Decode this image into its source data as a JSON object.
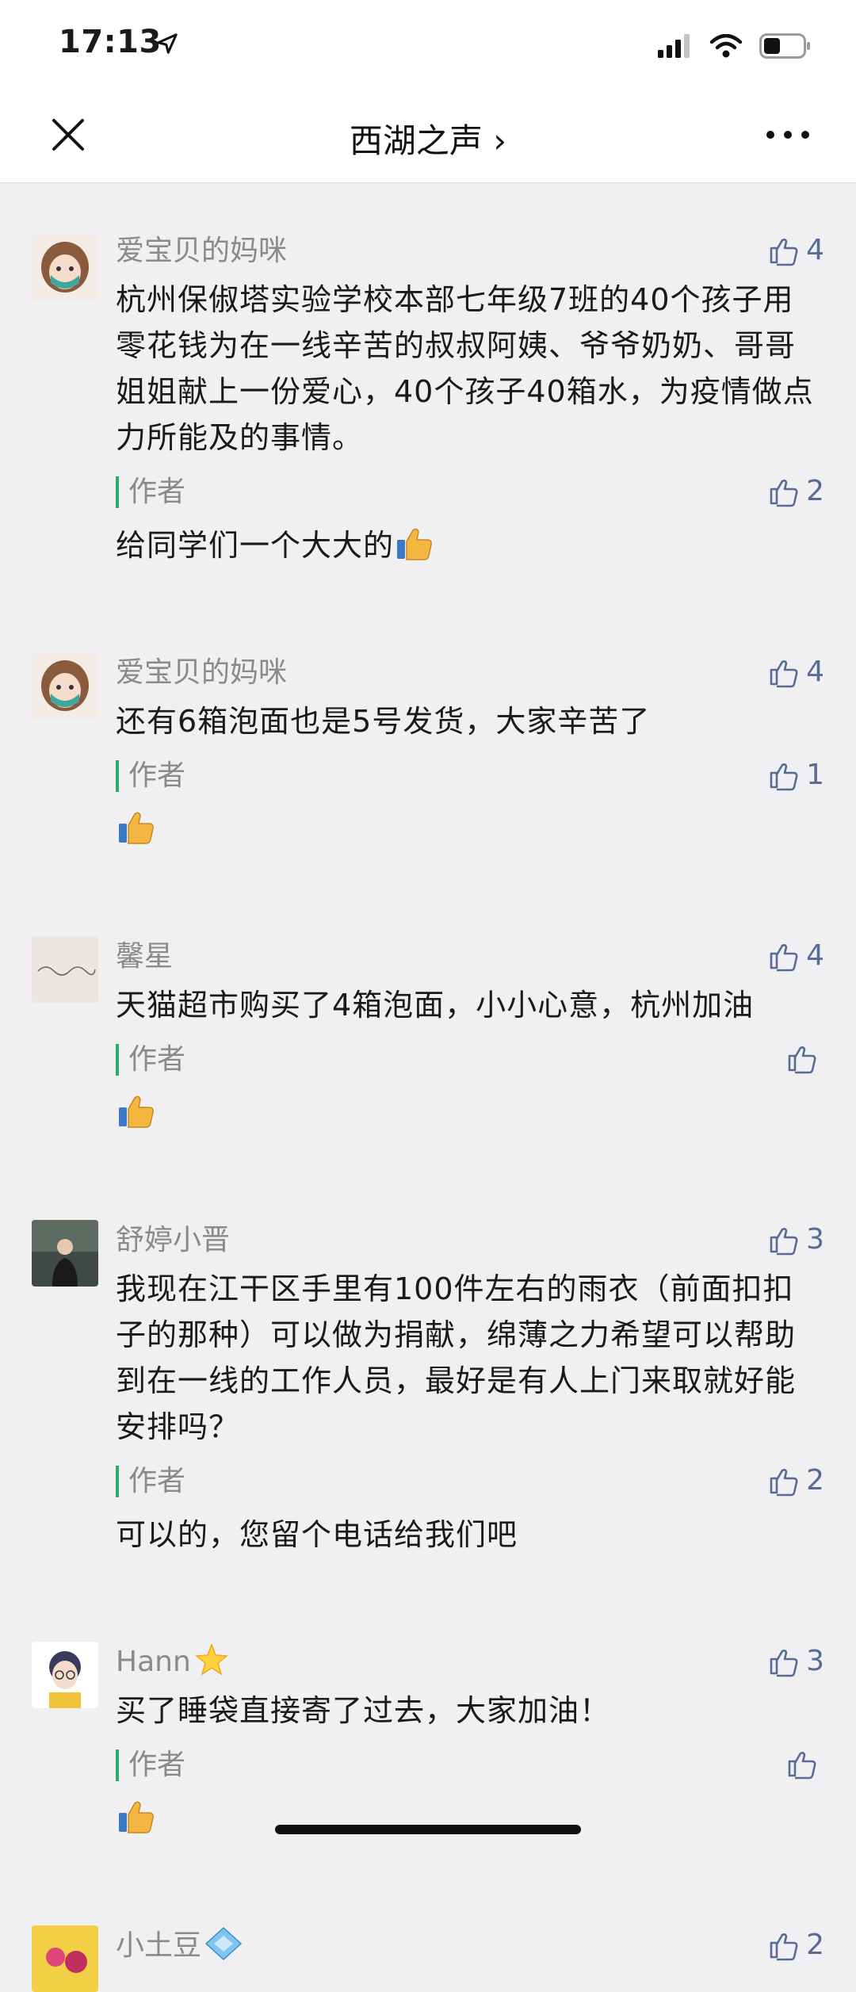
{
  "status_bar": {
    "time": "17:13"
  },
  "nav": {
    "title": "西湖之声 ›"
  },
  "comments": [
    {
      "name": "爱宝贝的妈咪",
      "likes": "4",
      "text": "杭州保俶塔实验学校本部七年级7班的40个孩子用零花钱为在一线辛苦的叔叔阿姨、爷爷奶奶、哥哥姐姐献上一份爱心，40个孩子40箱水，为疫情做点力所能及的事情。",
      "reply": {
        "author": "作者",
        "likes": "2",
        "text": "给同学们一个大大的"
      }
    },
    {
      "name": "爱宝贝的妈咪",
      "likes": "4",
      "text": "还有6箱泡面也是5号发货，大家辛苦了",
      "reply": {
        "author": "作者",
        "likes": "1",
        "text": ""
      }
    },
    {
      "name": "馨星",
      "likes": "4",
      "text": "天猫超市购买了4箱泡面，小小心意，杭州加油",
      "reply": {
        "author": "作者",
        "likes": "",
        "text": ""
      }
    },
    {
      "name": "舒婷小晋",
      "likes": "3",
      "text": "我现在江干区手里有100件左右的雨衣（前面扣扣子的那种）可以做为捐献，绵薄之力希望可以帮助到在一线的工作人员，最好是有人上门来取就好能安排吗？",
      "reply": {
        "author": "作者",
        "likes": "2",
        "text": "可以的，您留个电话给我们吧"
      }
    },
    {
      "name": "Hann",
      "likes": "3",
      "text": "买了睡袋直接寄了过去，大家加油！",
      "reply": {
        "author": "作者",
        "likes": "",
        "text": ""
      }
    },
    {
      "name": "小土豆",
      "likes": "2",
      "text": "",
      "reply": null
    }
  ],
  "colors": {
    "accent": "#576b95",
    "author_bar": "#2aae67",
    "background": "#f0f0f2"
  }
}
